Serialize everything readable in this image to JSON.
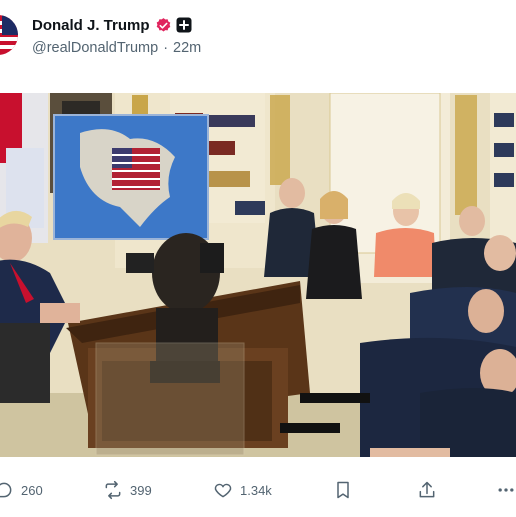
{
  "post": {
    "author_name": "Donald J. Trump",
    "handle": "@realDonaldTrump",
    "separator": "·",
    "time": "22m"
  },
  "actions": {
    "replies": "260",
    "reposts": "399",
    "likes": "1.34k"
  },
  "icons": {
    "verified": "verified-badge-icon",
    "affiliation": "plus-square-icon",
    "reply": "reply-bubble-icon",
    "repost": "repost-arrows-icon",
    "like": "heart-icon",
    "bookmark": "bookmark-icon",
    "share": "share-upload-icon",
    "more": "more-dots-icon"
  },
  "colors": {
    "verified_badge": "#e0245e",
    "secondary_text": "#536471",
    "primary_text": "#0f1419"
  }
}
